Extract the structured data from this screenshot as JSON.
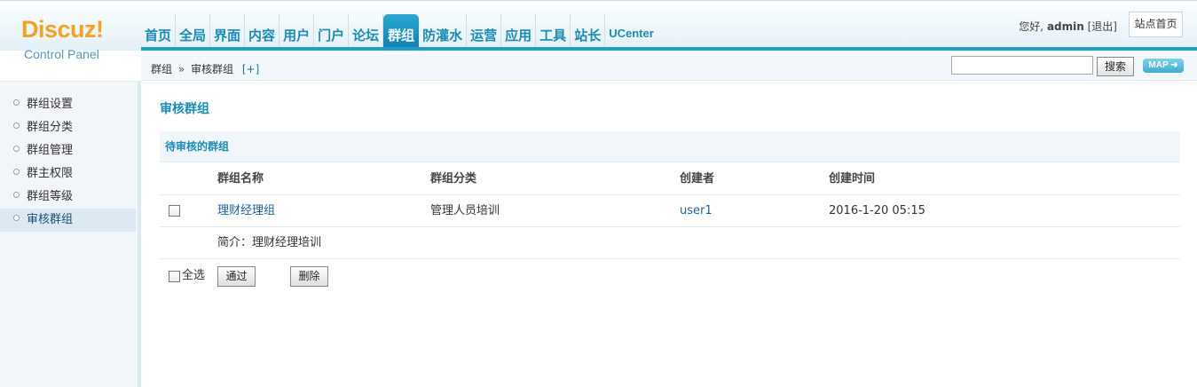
{
  "logo": {
    "name": "Discuz!",
    "subtitle": "Control Panel"
  },
  "nav": [
    "首页",
    "全局",
    "界面",
    "内容",
    "用户",
    "门户",
    "论坛",
    "群组",
    "防灌水",
    "运营",
    "应用",
    "工具",
    "站长",
    "UCenter"
  ],
  "nav_active": "群组",
  "user": {
    "greeting": "您好,",
    "name": "admin",
    "logout": "[退出]",
    "site_home": "站点首页"
  },
  "breadcrumb": {
    "parent": "群组",
    "sep": "»",
    "current": "审核群组",
    "add": "[+]"
  },
  "search": {
    "value": "",
    "button": "搜索",
    "map": "MAP ➜"
  },
  "sidebar": [
    "群组设置",
    "群组分类",
    "群组管理",
    "群主权限",
    "群组等级",
    "审核群组"
  ],
  "sidebar_active": "审核群组",
  "main": {
    "title": "审核群组",
    "section": "待审核的群组",
    "columns": [
      "群组名称",
      "群组分类",
      "创建者",
      "创建时间"
    ],
    "rows": [
      {
        "name": "理财经理组",
        "category": "管理人员培训",
        "creator": "user1",
        "time": "2016-1-20 05:15",
        "intro": "简介：理财经理培训"
      }
    ],
    "select_all": "全选",
    "approve": "通过",
    "delete": "删除"
  },
  "colors": {
    "accent": "#1b8cb3",
    "logo": "#f2a226",
    "active_tab": "#1e9dc6"
  }
}
